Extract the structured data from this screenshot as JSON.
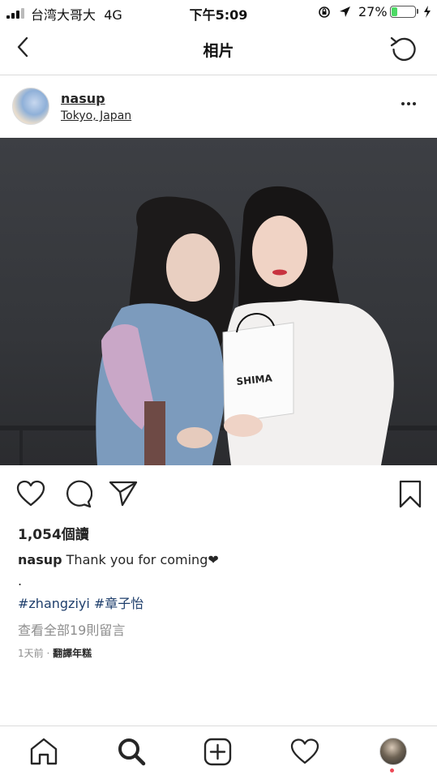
{
  "status_bar": {
    "carrier": "台湾大哥大",
    "network": "4G",
    "time": "下午5:09",
    "battery_percent": "27%",
    "battery_level": 0.27,
    "battery_color": "#4cd964"
  },
  "header": {
    "title": "相片",
    "back_icon": "chevron-left-icon",
    "refresh_icon": "refresh-icon"
  },
  "post": {
    "username": "nasup",
    "location": "Tokyo, Japan",
    "photo_bag_text": "SHIMA",
    "views": "1,054個讀",
    "caption_user": "nasup",
    "caption_text": "Thank you for coming❤",
    "caption_dot": ".",
    "hashtags": "#zhangziyi #章子怡",
    "view_comments": "查看全部19則留言",
    "time_ago": "1天前",
    "separator": "·",
    "translate": "翻譯年糕"
  },
  "colors": {
    "hashtag": "#1f3f6c",
    "muted": "#8e8e8e",
    "notification_dot": "#ed4956"
  },
  "nav": {
    "items": [
      "home-icon",
      "search-icon",
      "add-post-icon",
      "activity-heart-icon",
      "profile-avatar"
    ]
  }
}
